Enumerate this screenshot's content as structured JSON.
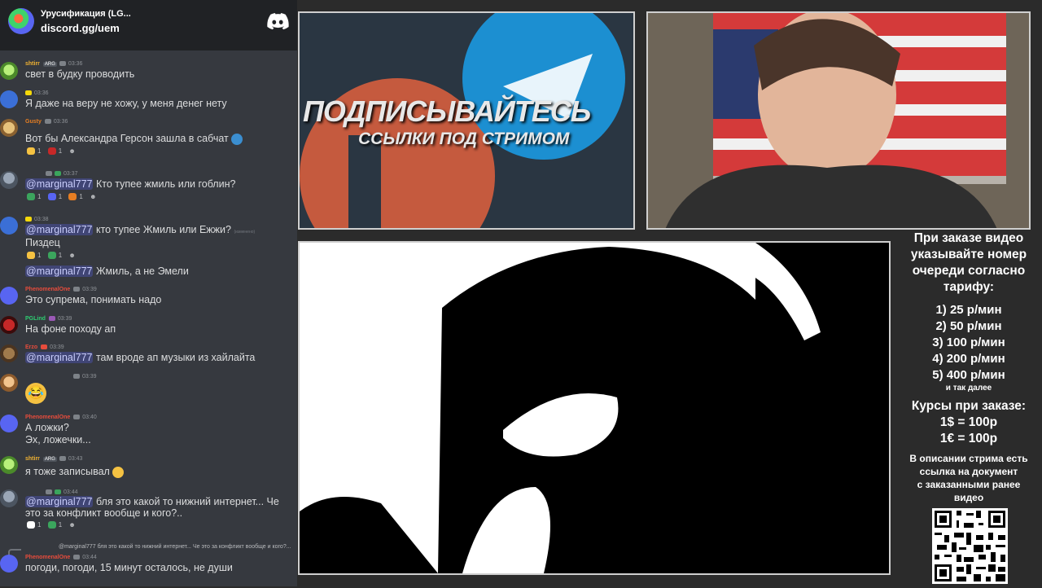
{
  "chat": {
    "server_name": "Урусификация (LG...",
    "server_link": "discord.gg/uem",
    "messages": [
      {
        "user": "shtirr",
        "tag": "ARG",
        "time": "03:36",
        "text": "свет в будку проводить"
      },
      {
        "user": "",
        "time": "03:36",
        "text": "Я даже на веру не хожу, у меня денег нету"
      },
      {
        "user": "Gusty",
        "time": "03:36",
        "text": "Вот бы Александра Герсон зашла в сабчат",
        "reactions": [
          "1",
          "1"
        ]
      },
      {
        "user": "",
        "time": "03:37",
        "mention": "@marginal777",
        "text": " Кто тупее жмиль или гоблин?",
        "reactions": [
          "1",
          "1",
          "1"
        ]
      },
      {
        "user": "",
        "time": "03:38",
        "mention": "@marginal777",
        "text": " кто тупее Жмиль или Ежжи?",
        "edited": "(изменено)",
        "text2": "Пиздец",
        "reactions": [
          "1",
          "1"
        ],
        "mention2": "@marginal777",
        "text3": " Жмиль, а не Эмели"
      },
      {
        "user": "PhenomenalOne",
        "time": "03:39",
        "text": "Это супрема, понимать надо"
      },
      {
        "user": "PGLind",
        "time": "03:39",
        "text": "На фоне походу ап"
      },
      {
        "user": "Erzo",
        "time": "03:39",
        "mention": "@marginal777",
        "text": " там вроде ап музыки из хайлайта"
      },
      {
        "user": "",
        "time": "03:39",
        "emoji": "😂"
      },
      {
        "user": "PhenomenalOne",
        "time": "03:40",
        "text": "А ложки?",
        "text2": "Эх, ложечки..."
      },
      {
        "user": "shtirr",
        "tag": "ARG",
        "time": "03:43",
        "text": "я тоже записывал"
      },
      {
        "user": "",
        "time": "03:44",
        "mention": "@marginal777",
        "text": " бля это какой то нижний интернет... Че",
        "text2": "это за конфликт вообще и кого?..",
        "reactions": [
          "1",
          "1"
        ]
      },
      {
        "user": "PhenomenalOne",
        "time": "03:44",
        "reply": "@marginal777  бля это какой то нижний интернет... Че это за конфликт вообще и кого?...",
        "text": "погоди, погоди, 15 минут осталось, не души"
      }
    ]
  },
  "banner": {
    "title": "ПОДПИСЫВАЙТЕСЬ",
    "subtitle": "ССЫЛКИ ПОД СТРИМОМ"
  },
  "info": {
    "heading": [
      "При заказе видео",
      "указывайте номер",
      "очереди согласно",
      "тарифу:"
    ],
    "tariffs": [
      "1) 25 р/мин",
      "2) 50 р/мин",
      "3) 100 р/мин",
      "4) 200 р/мин",
      "5) 400 р/мин"
    ],
    "etc": "и так далее",
    "rates_title": "Курсы при заказе:",
    "rates": [
      "1$ = 100р",
      "1€ = 100р"
    ],
    "desc": [
      "В описании стрима есть",
      "ссылка на документ",
      "с заказанными ранее",
      "видео"
    ]
  }
}
